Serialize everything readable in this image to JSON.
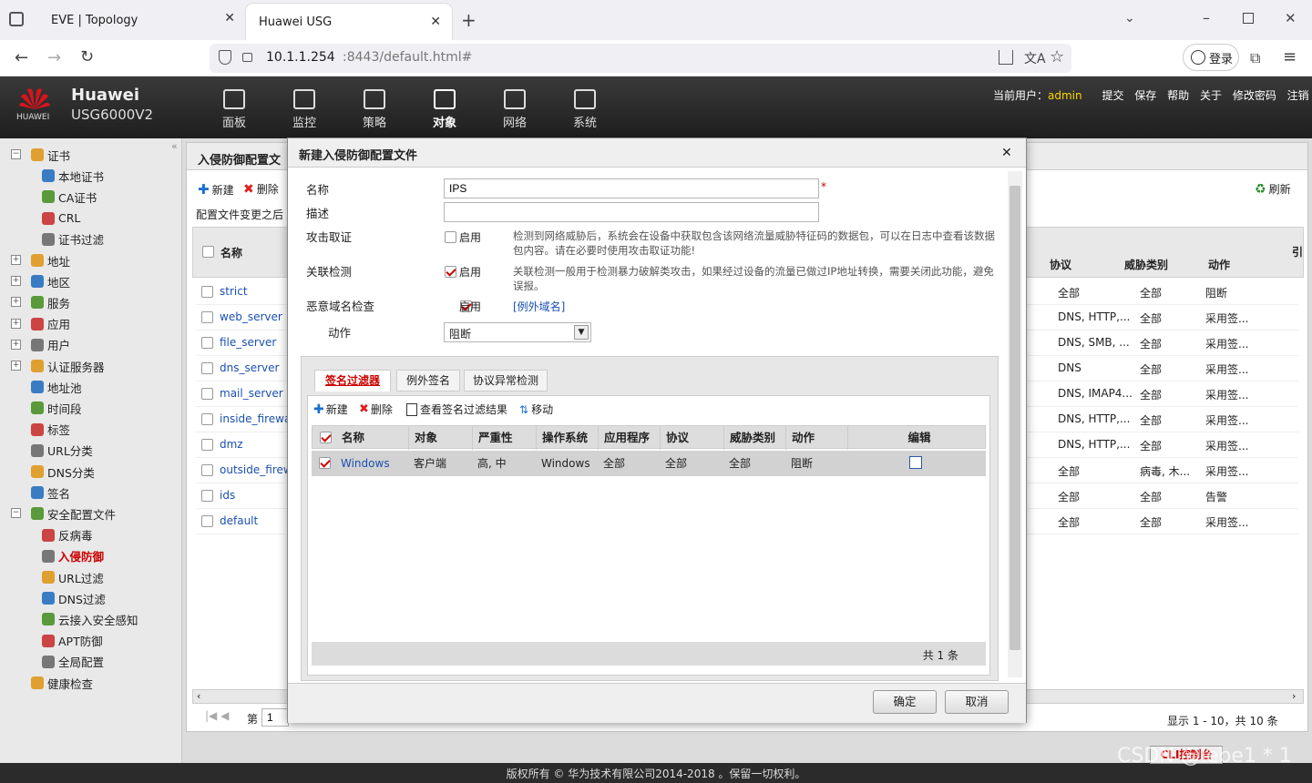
{
  "browser": {
    "tabs": [
      {
        "label": "EVE | Topology"
      },
      {
        "label": "Huawei USG"
      }
    ],
    "url_host": "10.1.1.254",
    "url_rest": ":8443/default.html#",
    "login_label": "登录"
  },
  "app": {
    "brand": "Huawei",
    "model": "USG6000V2",
    "logo_text": "HUAWEI",
    "nav": [
      "面板",
      "监控",
      "策略",
      "对象",
      "网络",
      "系统"
    ],
    "user_label": "当前用户：",
    "user": "admin",
    "links": [
      "提交",
      "保存",
      "帮助",
      "关于",
      "修改密码",
      "注销"
    ]
  },
  "sidebar": {
    "items": [
      {
        "label": "证书",
        "level": 0,
        "expand": "−"
      },
      {
        "label": "本地证书",
        "level": 2
      },
      {
        "label": "CA证书",
        "level": 2
      },
      {
        "label": "CRL",
        "level": 2
      },
      {
        "label": "证书过滤",
        "level": 2
      },
      {
        "label": "地址",
        "level": 0,
        "expand": "+"
      },
      {
        "label": "地区",
        "level": 0,
        "expand": "+"
      },
      {
        "label": "服务",
        "level": 0,
        "expand": "+"
      },
      {
        "label": "应用",
        "level": 0,
        "expand": "+"
      },
      {
        "label": "用户",
        "level": 0,
        "expand": "+"
      },
      {
        "label": "认证服务器",
        "level": 0,
        "expand": "+"
      },
      {
        "label": "地址池",
        "level": 1
      },
      {
        "label": "时间段",
        "level": 1
      },
      {
        "label": "标签",
        "level": 1
      },
      {
        "label": "URL分类",
        "level": 1
      },
      {
        "label": "DNS分类",
        "level": 1
      },
      {
        "label": "签名",
        "level": 1
      },
      {
        "label": "安全配置文件",
        "level": 0,
        "expand": "−"
      },
      {
        "label": "反病毒",
        "level": 2
      },
      {
        "label": "入侵防御",
        "level": 2,
        "selected": true
      },
      {
        "label": "URL过滤",
        "level": 2
      },
      {
        "label": "DNS过滤",
        "level": 2
      },
      {
        "label": "云接入安全感知",
        "level": 2
      },
      {
        "label": "APT防御",
        "level": 2
      },
      {
        "label": "全局配置",
        "level": 2
      },
      {
        "label": "健康检查",
        "level": 1
      }
    ]
  },
  "main": {
    "title": "入侵防御配置文",
    "new": "新建",
    "delete": "删除",
    "refresh": "刷新",
    "note": "配置文件变更之后",
    "col_name": "名称",
    "col_protocol": "协议",
    "col_threat": "威胁类别",
    "col_action": "动作",
    "col_more": "引",
    "rows": [
      {
        "name": "strict",
        "protocol": "全部",
        "threat": "全部",
        "action": "阻断"
      },
      {
        "name": "web_server",
        "protocol": "DNS, HTTP,...",
        "threat": "全部",
        "action": "采用签..."
      },
      {
        "name": "file_server",
        "protocol": "DNS, SMB, ...",
        "threat": "全部",
        "action": "采用签..."
      },
      {
        "name": "dns_server",
        "protocol": "DNS",
        "threat": "全部",
        "action": "采用签..."
      },
      {
        "name": "mail_server",
        "protocol": "DNS, IMAP4...",
        "threat": "全部",
        "action": "采用签..."
      },
      {
        "name": "inside_firewal",
        "protocol": "DNS, HTTP,...",
        "threat": "全部",
        "action": "采用签..."
      },
      {
        "name": "dmz",
        "protocol": "DNS, HTTP,...",
        "threat": "全部",
        "action": "采用签..."
      },
      {
        "name": "outside_firewa",
        "protocol": "全部",
        "threat": "病毒, 木...",
        "action": "采用签..."
      },
      {
        "name": "ids",
        "protocol": "全部",
        "threat": "全部",
        "action": "告警"
      },
      {
        "name": "default",
        "protocol": "全部",
        "threat": "全部",
        "action": "采用签..."
      }
    ],
    "page_label": "第",
    "page": "1",
    "summary": "显示 1 - 10，共 10 条"
  },
  "modal": {
    "title": "新建入侵防御配置文件",
    "name_label": "名称",
    "name_value": "IPS",
    "required": "*",
    "desc_label": "描述",
    "desc_value": "",
    "evidence_label": "攻击取证",
    "evidence_enabled": false,
    "evidence_desc": "检测到网络威胁后，系统会在设备中获取包含该网络流量威胁特征码的数据包，可以在日志中查看该数据包内容。请在必要时使用攻击取证功能!",
    "correlation_label": "关联检测",
    "correlation_enabled": true,
    "correlation_desc": "关联检测一般用于检测暴力破解类攻击，如果经过设备的流量已做过IP地址转换，需要关闭此功能，避免误报。",
    "dns_label": "恶意域名检查",
    "dns_enabled": true,
    "dns_link": "[例外域名]",
    "enable_text": "启用",
    "action_label": "动作",
    "action_value": "阻断",
    "tabs": [
      "签名过滤器",
      "例外签名",
      "协议异常检测"
    ],
    "toolbar": {
      "new": "新建",
      "delete": "删除",
      "view": "查看签名过滤结果",
      "move": "移动"
    },
    "columns": [
      "名称",
      "对象",
      "严重性",
      "操作系统",
      "应用程序",
      "协议",
      "威胁类别",
      "动作",
      "编辑"
    ],
    "rows": [
      {
        "name": "Windows",
        "object": "客户端",
        "severity": "高, 中",
        "os": "Windows",
        "app": "全部",
        "protocol": "全部",
        "threat": "全部",
        "action": "阻断"
      }
    ],
    "total": "共 1 条",
    "ok": "确定",
    "cancel": "取消"
  },
  "footer": {
    "copyright": "版权所有 © 华为技术有限公司2014-2018 。保留一切权利。",
    "cli": "CLI控制台",
    "watermark": "CSDN @lebe1 * 1"
  },
  "colors": {
    "accent": "#c00000",
    "link": "#1a4fb3",
    "header_dark": "#2a2a2a"
  }
}
